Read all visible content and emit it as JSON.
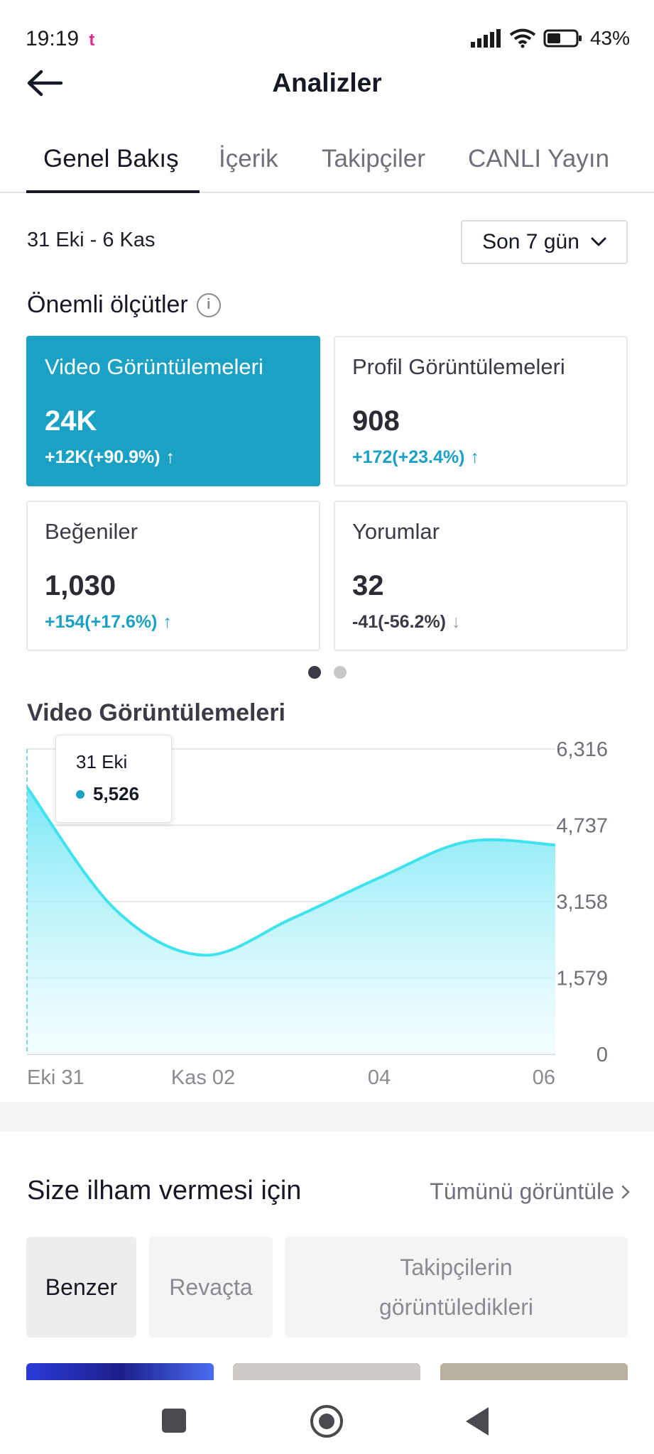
{
  "status_bar": {
    "time": "19:19",
    "battery": "43%",
    "app_icon": "tiktok-lite-icon"
  },
  "header": {
    "title": "Analizler",
    "back_icon": "arrow-left-icon"
  },
  "tabs": [
    {
      "label": "Genel Bakış",
      "active": true
    },
    {
      "label": "İçerik",
      "active": false
    },
    {
      "label": "Takipçiler",
      "active": false
    },
    {
      "label": "CANLI Yayın",
      "active": false
    }
  ],
  "date_range": "31 Eki - 6 Kas",
  "period_select": {
    "value": "Son 7 gün"
  },
  "key_metrics": {
    "title": "Önemli ölçütler",
    "cards": [
      {
        "label": "Video Görüntülemeleri",
        "value": "24K",
        "change": "+12K(+90.9%)",
        "direction": "up",
        "selected": true
      },
      {
        "label": "Profil Görüntülemeleri",
        "value": "908",
        "change": "+172(+23.4%)",
        "direction": "up",
        "selected": false
      },
      {
        "label": "Beğeniler",
        "value": "1,030",
        "change": "+154(+17.6%)",
        "direction": "up",
        "selected": false
      },
      {
        "label": "Yorumlar",
        "value": "32",
        "change": "-41(-56.2%)",
        "direction": "down",
        "selected": false
      }
    ],
    "pager": {
      "total": 2,
      "current": 0
    }
  },
  "chart_title": "Video Görüntülemeleri",
  "chart_data": {
    "type": "area",
    "x": [
      "2024-10-31",
      "2024-11-01",
      "2024-11-02",
      "2024-11-03",
      "2024-11-04",
      "2024-11-05",
      "2024-11-06"
    ],
    "series": [
      {
        "values": [
          5526,
          3000,
          2050,
          2800,
          3650,
          4400,
          4330
        ]
      }
    ],
    "x_tick_labels": [
      "Eki 31",
      "Kas 02",
      "04",
      "06"
    ],
    "x_tick_indices": [
      0,
      2,
      4,
      6
    ],
    "y_ticks": [
      0,
      1579,
      3158,
      4737,
      6316
    ],
    "y_tick_labels": [
      "0",
      "1,579",
      "3,158",
      "4,737",
      "6,316"
    ],
    "ylim": [
      0,
      6316
    ],
    "grid": true,
    "line_color": "#3ee3ee",
    "tooltip": {
      "date": "31 Eki",
      "value": "5,526"
    }
  },
  "inspiration": {
    "title": "Size ilham vermesi için",
    "see_all": "Tümünü görüntüle",
    "chips": [
      "Benzer",
      "Revaçta",
      "Takipçilerin görüntüledikleri"
    ]
  },
  "colors": {
    "accent": "#1ba1c4",
    "chart_line": "#3ee3ee",
    "text_primary": "#161823",
    "text_secondary": "#6f7078"
  }
}
